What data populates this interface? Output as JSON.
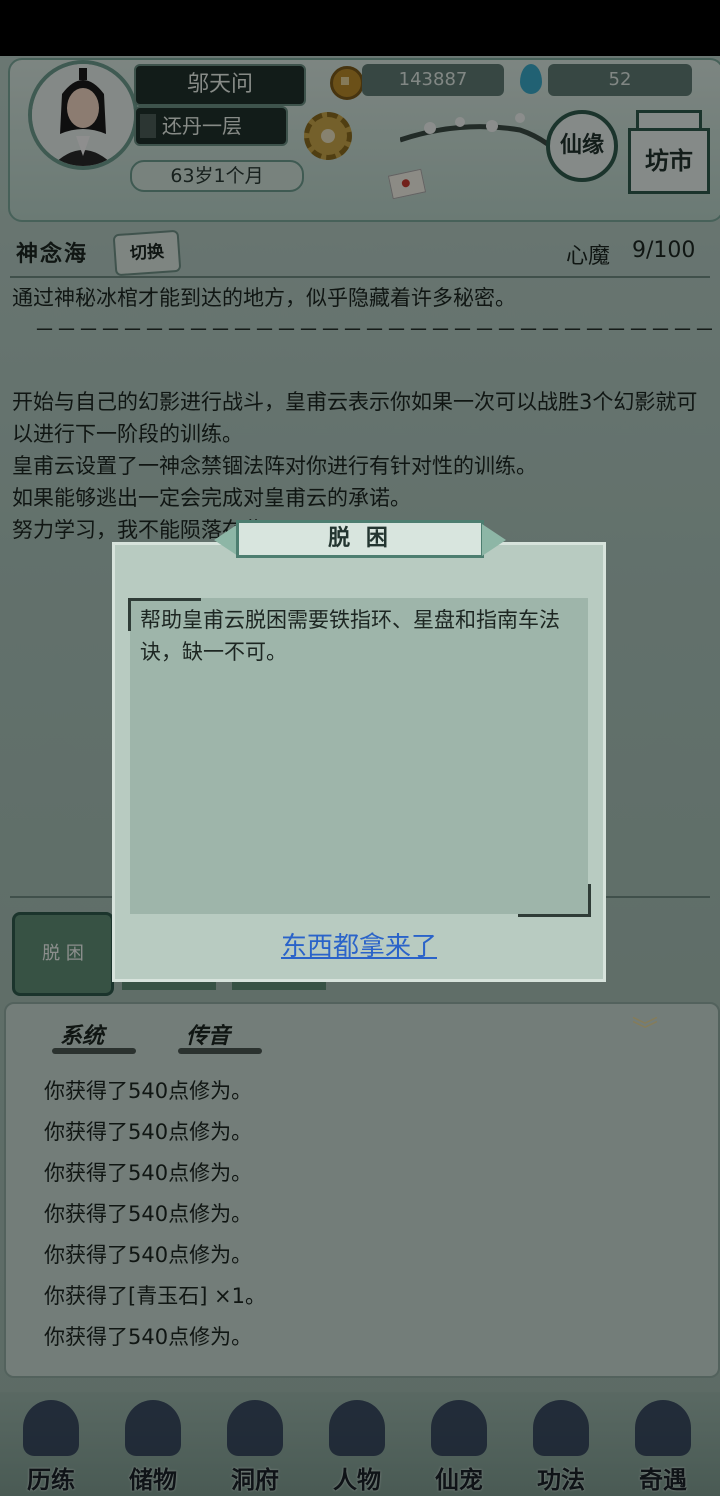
{
  "header": {
    "player_name": "邬天问",
    "realm": "还丹一层",
    "age": "63岁1个月",
    "coins": "143887",
    "spirit_water": "52",
    "xianyuan_label": "仙缘",
    "market_label": "坊市"
  },
  "subheader": {
    "location": "神念海",
    "switch_label": "切换",
    "heart_demon_label": "心魔",
    "heart_demon_value": "9/100"
  },
  "story": {
    "line1": "通过神秘冰棺才能到达的地方，似乎隐藏着许多秘密。",
    "dashes": "－－－－－－－－－－－－－－－－－－－－－－－－－－－－－－－－－－－－－－－－－－",
    "line2": "开始与自己的幻影进行战斗，皇甫云表示你如果一次可以战胜3个幻影就可以进行下一阶段的训练。",
    "line3": "皇甫云设置了一神念禁锢法阵对你进行有针对性的训练。",
    "line4": "如果能够逃出一定会完成对皇甫云的承诺。",
    "line5": "努力学习，我不能陨落在此。"
  },
  "action_tab": {
    "label": "脱 困"
  },
  "dialog": {
    "title": "脱 困",
    "text": "帮助皇甫云脱困需要铁指环、星盘和指南车法诀，缺一不可。",
    "link": "东西都拿来了"
  },
  "log": {
    "tab_system": "系统",
    "tab_message": "传音",
    "entries": [
      "你获得了540点修为。",
      "你获得了540点修为。",
      "你获得了540点修为。",
      "你获得了540点修为。",
      "你获得了540点修为。",
      "你获得了[青玉石] ×1。",
      "你获得了540点修为。"
    ]
  },
  "nav": [
    "历练",
    "储物",
    "洞府",
    "人物",
    "仙宠",
    "功法",
    "奇遇"
  ]
}
